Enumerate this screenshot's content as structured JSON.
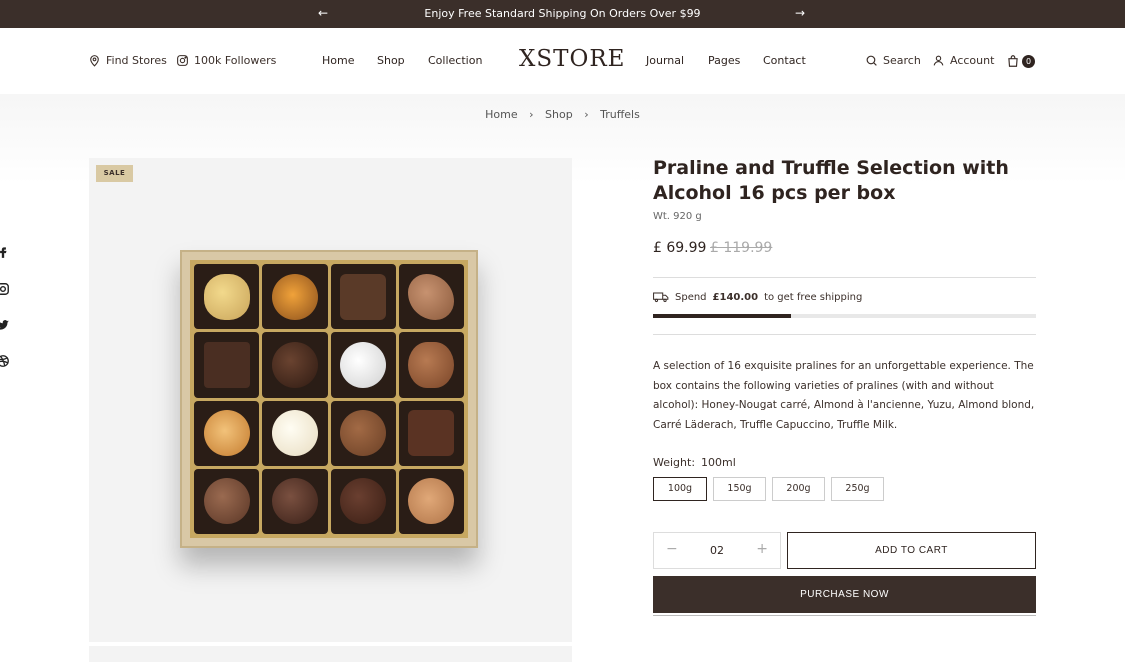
{
  "announcement": {
    "message": "Enjoy Free Standard Shipping On Orders Over $99",
    "prev_icon": "arrow-left-icon",
    "next_icon": "arrow-right-icon"
  },
  "header": {
    "find_stores": "Find Stores",
    "followers": "100k Followers",
    "nav_left": [
      "Home",
      "Shop",
      "Collection"
    ],
    "logo": "XSTORE",
    "nav_right": [
      "Journal",
      "Pages",
      "Contact"
    ],
    "search": "Search",
    "account": "Account",
    "cart_count": "0"
  },
  "breadcrumb": [
    "Home",
    "Shop",
    "Truffels"
  ],
  "social_icons": [
    "facebook-icon",
    "instagram-icon",
    "twitter-icon",
    "dribbble-icon"
  ],
  "product": {
    "badge": "SALE",
    "title": "Praline and Truffle Selection with Alcohol 16 pcs per box",
    "weight_info": "Wt. 920 g",
    "price": "£ 69.99",
    "old_price": "£ 119.99",
    "shipping": {
      "prefix": "Spend",
      "amount": "£140.00",
      "suffix": "to get free shipping",
      "progress_fraction": 0.36
    },
    "description": "A selection of 16 exquisite pralines for an unforgettable experience. The box contains the following varieties of pralines (with and without alcohol): Honey-Nougat carré, Almond à l'ancienne, Yuzu, Almond blond, Carré Läderach, Truffle Capuccino, Truffle Milk.",
    "weight_label": "Weight:",
    "weight_selected": "100ml",
    "weight_options": [
      "100g",
      "150g",
      "200g",
      "250g"
    ],
    "quantity": "02",
    "add_to_cart": "ADD TO CART",
    "purchase_now": "PURCHASE NOW"
  },
  "colors": {
    "brand_dark": "#3b2f2a",
    "sale_badge": "#d9c9a3"
  }
}
